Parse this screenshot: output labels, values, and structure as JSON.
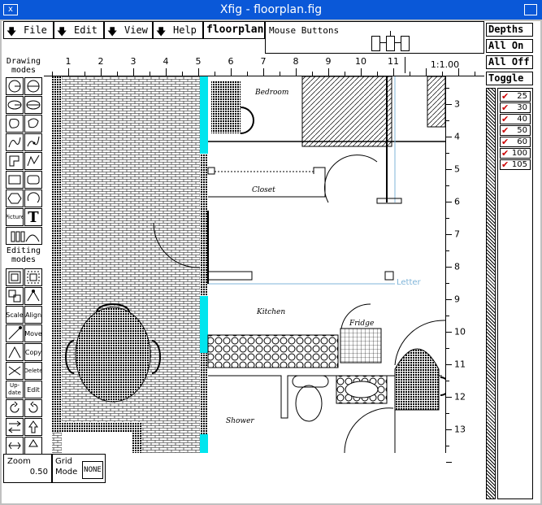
{
  "window": {
    "title": "Xfig - floorplan.fig",
    "close_glyph": "x"
  },
  "menu": {
    "file": "File",
    "edit": "Edit",
    "view": "View",
    "help": "Help"
  },
  "app_name": "floorplan",
  "mouse_buttons_label": "Mouse Buttons",
  "depths": {
    "header": "Depths",
    "all_on": "All On",
    "all_off": "All Off",
    "toggle": "Toggle",
    "items": [
      "25",
      "30",
      "40",
      "50",
      "60",
      "100",
      "105"
    ]
  },
  "modes": {
    "drawing_line1": "Drawing",
    "drawing_line2": "modes",
    "editing_line1": "Editing",
    "editing_line2": "modes"
  },
  "tools": {
    "picture": "Picture",
    "text": "T",
    "scale": "Scale",
    "align": "Align",
    "move": "Move",
    "copy": "Copy",
    "update": "Up-date",
    "edit": "Edit",
    "delete": "Delete"
  },
  "ruler": {
    "h_numbers": [
      "1",
      "2",
      "3",
      "4",
      "5",
      "6",
      "7",
      "8",
      "9",
      "10",
      "11"
    ],
    "v_numbers": [
      "3",
      "4",
      "5",
      "6",
      "7",
      "8",
      "9",
      "10",
      "11",
      "12",
      "13"
    ],
    "scale": "1:1.00"
  },
  "plan_labels": {
    "bedroom": "Bedroom",
    "closet": "Closet",
    "kitchen": "Kitchen",
    "fridge": "Fridge",
    "shower": "Shower",
    "letter": "Letter"
  },
  "zoom": {
    "label": "Zoom",
    "value": "0.50"
  },
  "grid": {
    "label_line1": "Grid",
    "label_line2": "Mode",
    "value": "NONE"
  },
  "colors": {
    "titlebar": "#0a58d8",
    "wall_accent": "#00e5ee",
    "letter_guide": "#7fb4d8"
  }
}
